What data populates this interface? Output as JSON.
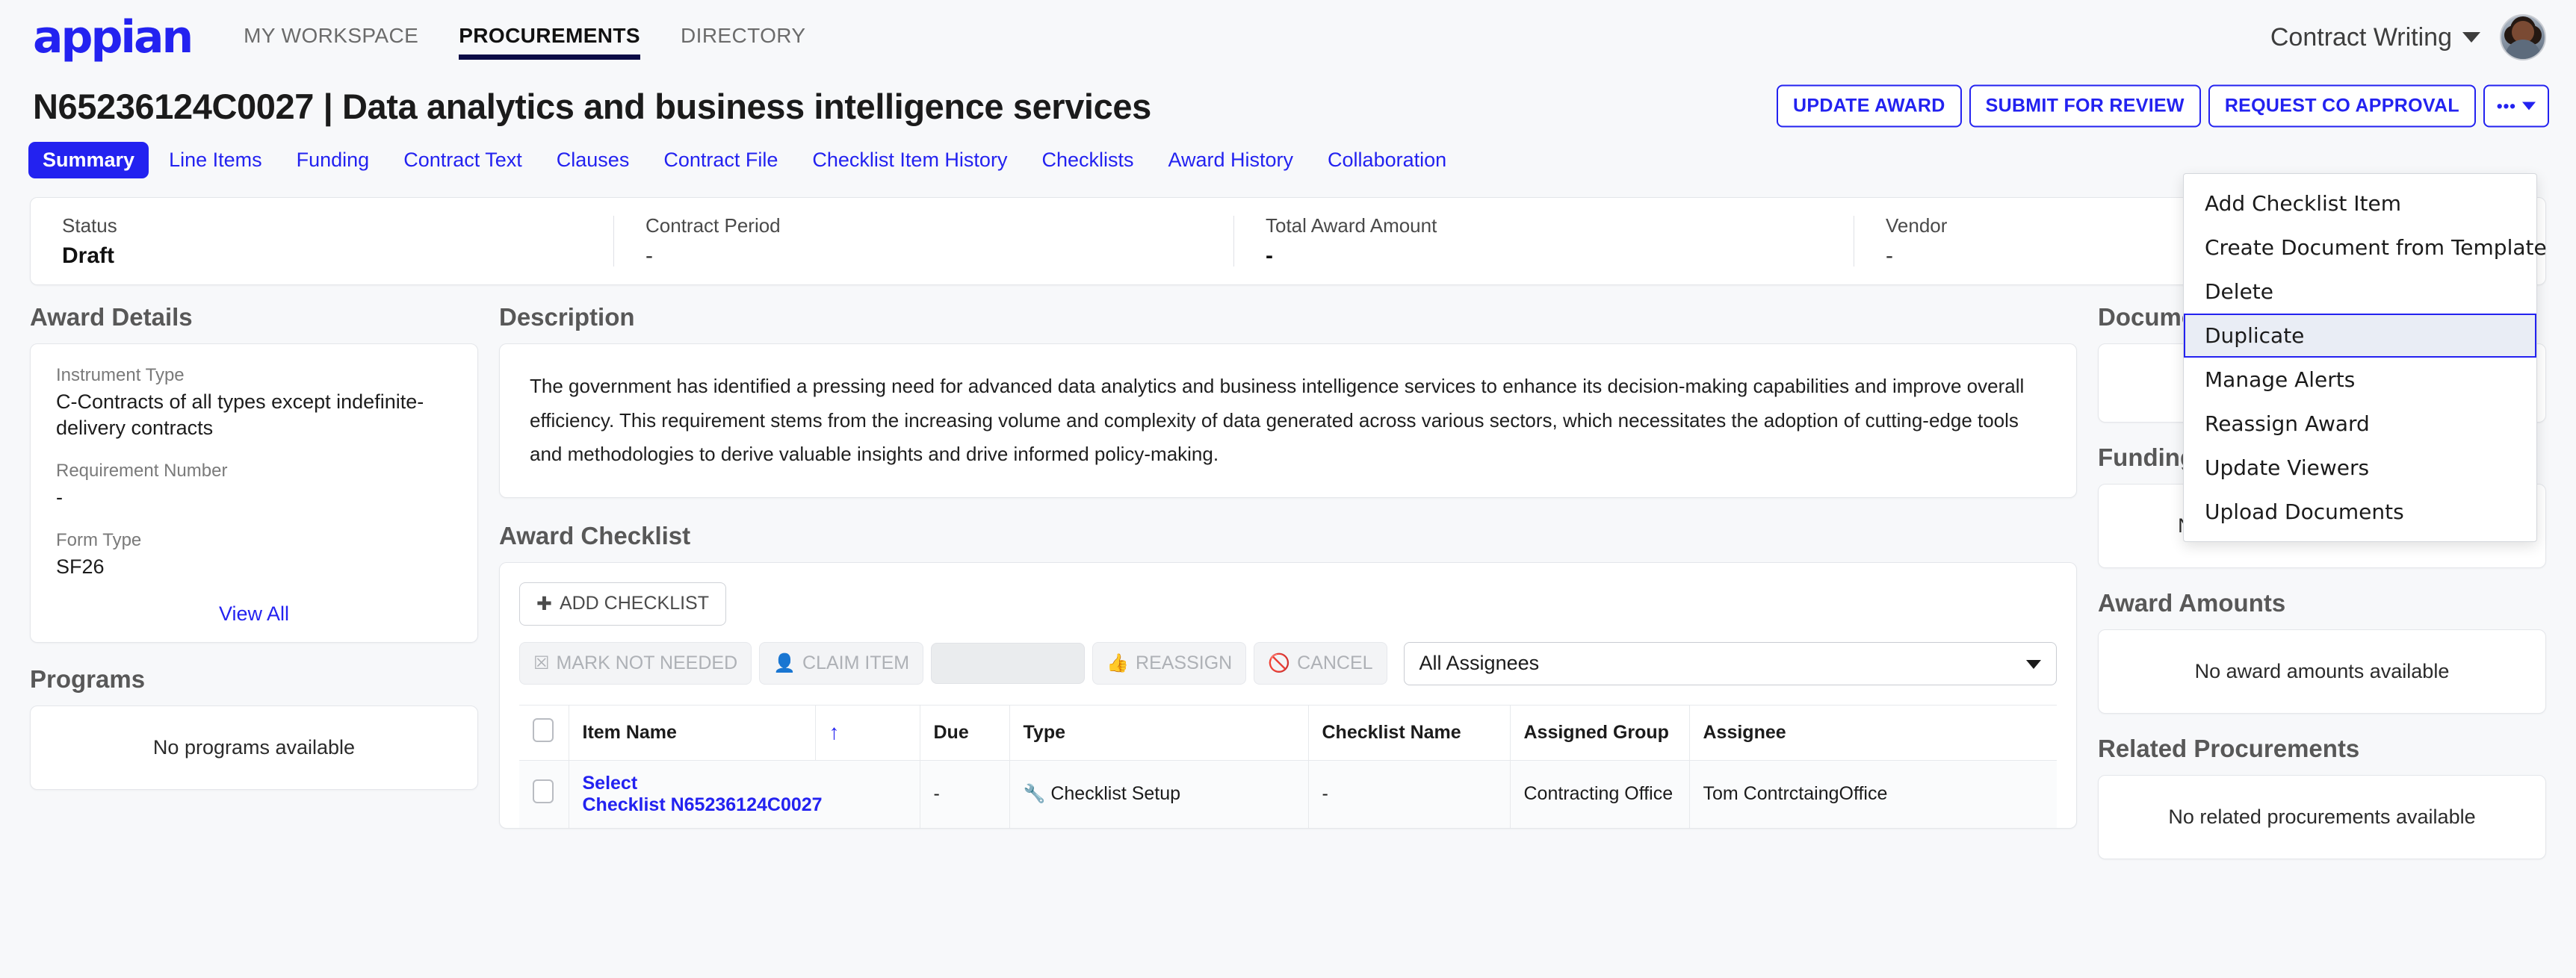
{
  "brand": {
    "logo_text": "appian",
    "accent": "#2322f0"
  },
  "topnav": {
    "items": [
      {
        "label": "MY WORKSPACE",
        "active": false
      },
      {
        "label": "PROCUREMENTS",
        "active": true
      },
      {
        "label": "DIRECTORY",
        "active": false
      }
    ],
    "user_name": "Contract Writing"
  },
  "header": {
    "title": "N65236124C0027 | Data analytics and business intelligence services",
    "actions": [
      {
        "label": "UPDATE AWARD"
      },
      {
        "label": "SUBMIT FOR REVIEW"
      },
      {
        "label": "REQUEST CO APPROVAL"
      }
    ],
    "more_dots": "•••"
  },
  "more_menu": {
    "items": [
      {
        "label": "Add Checklist Item",
        "selected": false
      },
      {
        "label": "Create Document from Template",
        "selected": false
      },
      {
        "label": "Delete",
        "selected": false
      },
      {
        "label": "Duplicate",
        "selected": true
      },
      {
        "label": "Manage Alerts",
        "selected": false
      },
      {
        "label": "Reassign Award",
        "selected": false
      },
      {
        "label": "Update Viewers",
        "selected": false
      },
      {
        "label": "Upload Documents",
        "selected": false
      }
    ]
  },
  "tabs": [
    {
      "label": "Summary",
      "active": true
    },
    {
      "label": "Line Items",
      "active": false
    },
    {
      "label": "Funding",
      "active": false
    },
    {
      "label": "Contract Text",
      "active": false
    },
    {
      "label": "Clauses",
      "active": false
    },
    {
      "label": "Contract File",
      "active": false
    },
    {
      "label": "Checklist Item History",
      "active": false
    },
    {
      "label": "Checklists",
      "active": false
    },
    {
      "label": "Award History",
      "active": false
    },
    {
      "label": "Collaboration",
      "active": false
    }
  ],
  "status_strip": [
    {
      "label": "Status",
      "value": "Draft",
      "bold": true
    },
    {
      "label": "Contract Period",
      "value": "-",
      "bold": false
    },
    {
      "label": "Total Award Amount",
      "value": "-",
      "bold": true
    },
    {
      "label": "Vendor",
      "value": "-",
      "bold": false
    }
  ],
  "award_details": {
    "title": "Award Details",
    "fields": [
      {
        "label": "Instrument Type",
        "value": "C-Contracts of all types except indefinite-delivery contracts"
      },
      {
        "label": "Requirement Number",
        "value": "-"
      },
      {
        "label": "Form Type",
        "value": "SF26"
      }
    ],
    "view_all": "View All"
  },
  "programs": {
    "title": "Programs",
    "empty": "No programs available"
  },
  "description": {
    "title": "Description",
    "text": "The government has identified a pressing need for advanced data analytics and business intelligence services to enhance its decision-making capabilities and improve overall efficiency. This requirement stems from the increasing volume and complexity of data generated across various sectors, which necessitates the adoption of cutting-edge tools and methodologies to derive valuable insights and drive informed policy-making."
  },
  "award_checklist": {
    "title": "Award Checklist",
    "add_button": "ADD CHECKLIST",
    "add_icon": "✚",
    "toolbar": [
      {
        "label": "MARK NOT NEEDED",
        "icon": "▣"
      },
      {
        "label": "CLAIM ITEM",
        "icon": "👤"
      },
      {
        "label": "REASSIGN",
        "icon": "👍"
      },
      {
        "label": "CANCEL",
        "icon": "⃠"
      }
    ],
    "assignee_filter": "All Assignees",
    "columns": [
      "Item Name",
      "",
      "Due",
      "Type",
      "Checklist Name",
      "Assigned Group",
      "Assignee"
    ],
    "sort_indicator": "↑",
    "rows": [
      {
        "item_name": "Select",
        "item_name_sub": "Checklist N65236124C0027",
        "due": "-",
        "type": "Checklist Setup",
        "type_icon": "🔧",
        "checklist_name": "-",
        "assigned_group": "Contracting Office",
        "assignee": "Tom ContrctaingOffice"
      }
    ]
  },
  "right_panels": [
    {
      "title": "Documents",
      "empty": ""
    },
    {
      "title": "Funding",
      "empty": "No funding information available"
    },
    {
      "title": "Award Amounts",
      "empty": "No award amounts available"
    },
    {
      "title": "Related Procurements",
      "empty": "No related procurements available"
    }
  ]
}
